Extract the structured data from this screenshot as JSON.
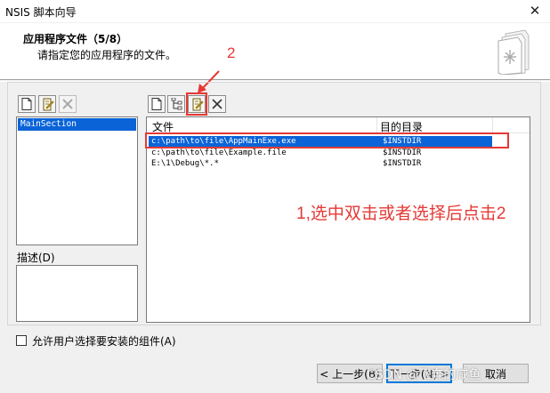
{
  "window": {
    "title": "NSIS 脚本向导",
    "close_glyph": "✕"
  },
  "header": {
    "title": "应用程序文件（5/8）",
    "subtitle": "请指定您的应用程序的文件。",
    "icon": "installer-box-icon"
  },
  "annotations": {
    "step2": "2",
    "step1": "1,选中双击或者选择后点击2",
    "color": "#e53935"
  },
  "sections": {
    "items": [
      "MainSection"
    ]
  },
  "description": {
    "label": "描述(D)"
  },
  "files": {
    "columns": [
      "文件",
      "目的目录"
    ],
    "rows": [
      {
        "file": "c:\\path\\to\\file\\AppMainExe.exe",
        "dest": "$INSTDIR",
        "selected": true
      },
      {
        "file": "c:\\path\\to\\file\\Example.file",
        "dest": "$INSTDIR",
        "selected": false
      },
      {
        "file": "E:\\1\\Debug\\*.*",
        "dest": "$INSTDIR",
        "selected": false
      }
    ]
  },
  "checkbox": {
    "label": "允许用户选择要安装的组件(A)",
    "checked": false
  },
  "buttons": {
    "back": "< 上一步(B)",
    "next": "下一步(N) >",
    "cancel": "取消"
  },
  "watermark": "CSDN @飞奔的咸鱼",
  "colors": {
    "selection": "#0a64d8",
    "accent": "#0078d7"
  }
}
